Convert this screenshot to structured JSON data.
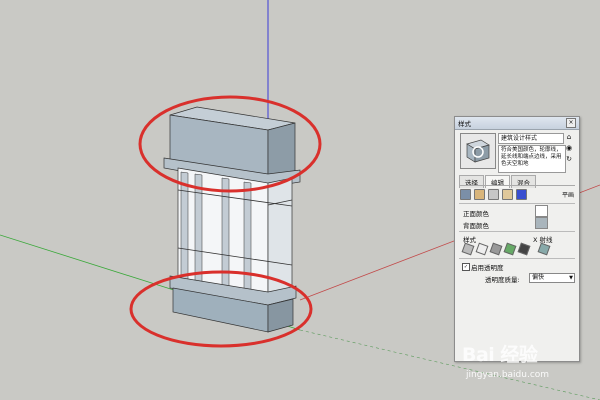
{
  "panel": {
    "title": "样式",
    "close": "×",
    "style_name": "建筑设计样式",
    "description": "符合美国颜色，轮廓线，延长线和端点边线，采用色天空和地",
    "tabs": [
      "选择",
      "编辑",
      "混合"
    ],
    "edit_side_label": "平画",
    "front_color_label": "正面颜色",
    "back_color_label": "背面颜色",
    "style_label": "样式",
    "xray_label": "X 射线",
    "transparency_checkbox": "启用透明度",
    "transparency_quality_label": "透明度质量:",
    "transparency_quality_value": "偏快",
    "front_color": "#ffffff",
    "back_color": "#a9b5bc"
  },
  "watermark": {
    "logo": "Bai 经验",
    "url": "jingyan.baidu.com"
  },
  "colors": {
    "background": "#c9c9c5",
    "highlight_ellipse": "#d9302c",
    "model_face_front": "#f4f6f8",
    "model_face_blue": "#9fb0bc"
  }
}
